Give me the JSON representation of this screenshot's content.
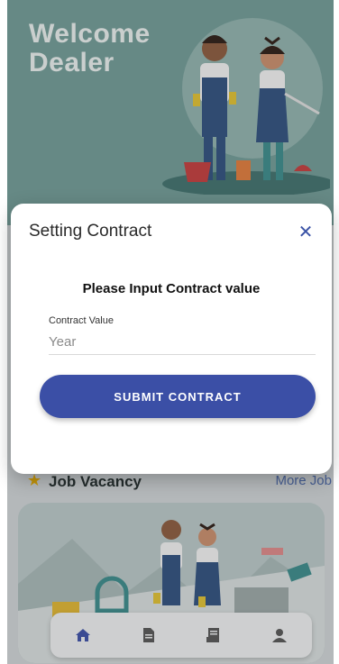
{
  "hero": {
    "title_line1": "Welcome",
    "title_line2": "Dealer"
  },
  "section": {
    "title": "Job Vacancy",
    "more_link": "More Job",
    "icon": "star-icon"
  },
  "bottom_nav": [
    {
      "icon": "home-icon",
      "active": true
    },
    {
      "icon": "document-icon",
      "active": false
    },
    {
      "icon": "receipt-icon",
      "active": false
    },
    {
      "icon": "profile-icon",
      "active": false
    }
  ],
  "dialog": {
    "title": "Setting Contract",
    "close_icon": "close-icon",
    "prompt": "Please Input Contract value",
    "field_label": "Contract Value",
    "field_placeholder": "Year",
    "field_value": "",
    "submit_label": "SUBMIT CONTRACT"
  },
  "colors": {
    "primary": "#3b4fa6",
    "hero_bg": "#6f9a95",
    "accent_star": "#e0a800"
  }
}
